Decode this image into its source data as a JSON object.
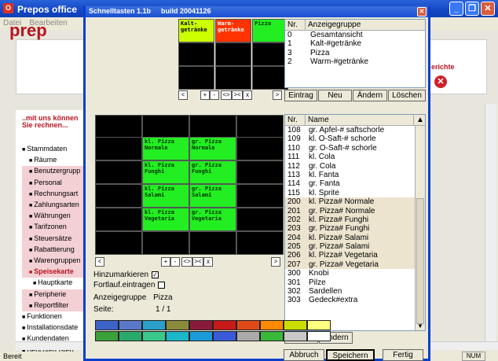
{
  "bg": {
    "title": "Prepos office",
    "menu": [
      "Datei",
      "Bearbeiten"
    ],
    "logo_text": "prep",
    "berichte": "erichte",
    "mituns": "..mit uns können Sie rechnen...",
    "sidelist": [
      {
        "t": "Stammdaten",
        "c": "bul"
      },
      {
        "t": "Räume",
        "c": "bul sub"
      },
      {
        "t": "Benutzergrupp",
        "c": "bul sub hl"
      },
      {
        "t": "Personal",
        "c": "bul sub hl"
      },
      {
        "t": "Rechnungsart",
        "c": "bul sub hl"
      },
      {
        "t": "Zahlungsarten",
        "c": "bul sub hl"
      },
      {
        "t": "Währungen",
        "c": "bul sub hl"
      },
      {
        "t": "Tarifzonen",
        "c": "bul sub hl"
      },
      {
        "t": "Steuersätze",
        "c": "bul sub hl"
      },
      {
        "t": "Rabattierung",
        "c": "bul sub hl"
      },
      {
        "t": "Warengruppen",
        "c": "bul sub hl"
      },
      {
        "t": "Speisekarte",
        "c": "bul sub hl active"
      },
      {
        "t": "Hauptkarte",
        "c": "bul sub2"
      },
      {
        "t": "Peripherie",
        "c": "bul sub hl"
      },
      {
        "t": "Reportfilter",
        "c": "bul sub hl"
      },
      {
        "t": "Funktionen",
        "c": "bul"
      },
      {
        "t": "Installationsdate",
        "c": "bul"
      },
      {
        "t": "Kundendaten",
        "c": "bul"
      },
      {
        "t": "Berichte/Listen",
        "c": "bul"
      }
    ],
    "status": "Bereit",
    "num": "NUM"
  },
  "dlg": {
    "title": "Schnelltasten 1.1b",
    "build": "build 20041126",
    "top_cells": [
      {
        "label": "Kalt-\ngetränke",
        "color": "yellow"
      },
      {
        "label": "Warm-\ngetränke",
        "color": "red"
      },
      {
        "label": "Pizza",
        "color": "green"
      }
    ],
    "top_nav": [
      "<",
      "+",
      "-",
      "<>",
      "><",
      "x",
      ">"
    ],
    "groups_header": {
      "nr": "Nr.",
      "name": "Anzeigegruppe"
    },
    "groups": [
      {
        "nr": "0",
        "name": "Gesamtansicht"
      },
      {
        "nr": "1",
        "name": "Kalt-#getränke"
      },
      {
        "nr": "3",
        "name": "Pizza"
      },
      {
        "nr": "2",
        "name": "Warm-#getränke"
      }
    ],
    "group_buttons": [
      "Eintrag",
      "Neu",
      "Ändern",
      "Löschen"
    ],
    "grid_cells": [
      {
        "r": 1,
        "c": 1,
        "label": "kl. Pizza\nNormale"
      },
      {
        "r": 1,
        "c": 2,
        "label": "gr. Pizza\nNormale"
      },
      {
        "r": 2,
        "c": 1,
        "label": "kl. Pizza\nFunghi"
      },
      {
        "r": 2,
        "c": 2,
        "label": "gr. Pizza\nFunghi"
      },
      {
        "r": 3,
        "c": 1,
        "label": "kl. Pizza\nSalami"
      },
      {
        "r": 3,
        "c": 2,
        "label": "gr. Pizza\nSalami"
      },
      {
        "r": 4,
        "c": 1,
        "label": "kl. Pizza\nVegetaria"
      },
      {
        "r": 4,
        "c": 2,
        "label": "gr. Pizza\nVegetaria"
      }
    ],
    "bottom_nav": [
      "<",
      "+",
      "-",
      "<>",
      "><",
      "x",
      ">"
    ],
    "hinzumarkieren": "Hinzumarkieren",
    "fortlauf": "Fortlauf.eintragen",
    "anzeigegruppe_label": "Anzeigegruppe",
    "anzeigegruppe_value": "Pizza",
    "seite_label": "Seite:",
    "seite_value": "1 / 1",
    "items_header": {
      "nr": "Nr.",
      "name": "Name"
    },
    "items": [
      {
        "nr": "108",
        "name": "gr. Apfel-# saftschorle",
        "tan": false
      },
      {
        "nr": "109",
        "name": "kl. O-Saft-# schorle",
        "tan": false
      },
      {
        "nr": "110",
        "name": "gr. O-Saft-# schorle",
        "tan": false
      },
      {
        "nr": "111",
        "name": "kl. Cola",
        "tan": false
      },
      {
        "nr": "112",
        "name": "gr. Cola",
        "tan": false
      },
      {
        "nr": "113",
        "name": "kl. Fanta",
        "tan": false
      },
      {
        "nr": "114",
        "name": "gr. Fanta",
        "tan": false
      },
      {
        "nr": "115",
        "name": "kl. Sprite",
        "tan": false
      },
      {
        "nr": "200",
        "name": "kl. Pizza# Normale",
        "tan": true
      },
      {
        "nr": "201",
        "name": "gr. Pizza# Normale",
        "tan": true
      },
      {
        "nr": "202",
        "name": "kl. Pizza# Funghi",
        "tan": true
      },
      {
        "nr": "203",
        "name": "gr. Pizza# Funghi",
        "tan": true
      },
      {
        "nr": "204",
        "name": "kl. Pizza# Salami",
        "tan": true
      },
      {
        "nr": "205",
        "name": "gr. Pizza# Salami",
        "tan": true
      },
      {
        "nr": "206",
        "name": "kl. Pizza# Vegetaria",
        "tan": true
      },
      {
        "nr": "207",
        "name": "gr. Pizza# Vegetaria",
        "tan": true
      },
      {
        "nr": "300",
        "name": "Knobi",
        "tan": false
      },
      {
        "nr": "301",
        "name": "Pilze",
        "tan": false
      },
      {
        "nr": "302",
        "name": "Sardellen",
        "tan": false
      },
      {
        "nr": "303",
        "name": "Gedeck#extra",
        "tan": false
      }
    ],
    "item_buttons": [
      "Eintrag",
      "Ändern"
    ],
    "palette_row1": [
      "#3c64c8",
      "#5a78c8",
      "#2aa0c8",
      "#8a8a3a",
      "#8a1a3a",
      "#c81a1a",
      "#e04a1a",
      "#ff8a00",
      "#ccdd00",
      "#ffff80"
    ],
    "palette_row2": [
      "#3aa03a",
      "#2aaa6a",
      "#3ac88a",
      "#1ab8c8",
      "#1a9ad8",
      "#3a5ad8",
      "#aaaaaa",
      "#3ab83a",
      "#c8c8c8",
      "#ffffff"
    ],
    "footer_buttons": [
      "Abbruch",
      "Speichern",
      "Fertig"
    ]
  }
}
